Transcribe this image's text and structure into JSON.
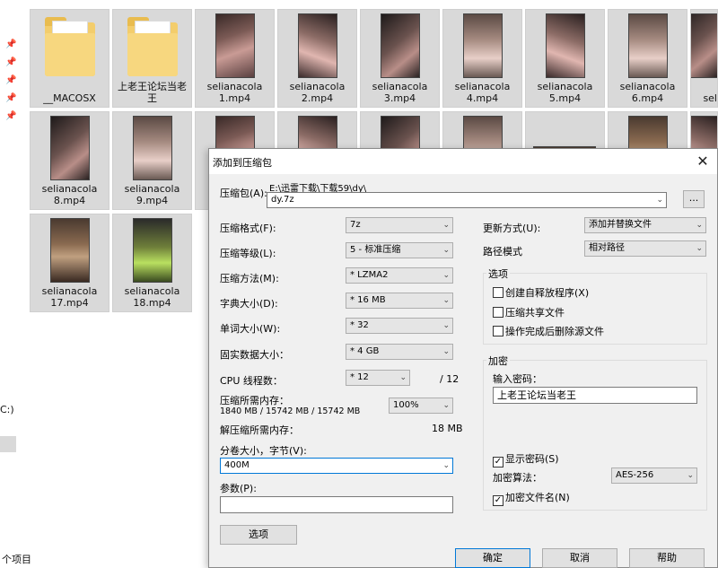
{
  "explorer": {
    "tiles": [
      {
        "label": "__MACOSX",
        "kind": "folder"
      },
      {
        "label": "上老王论坛当老王",
        "kind": "folder"
      },
      {
        "label": "selianacola 1.mp4",
        "kind": "video"
      },
      {
        "label": "selianacola 2.mp4",
        "kind": "video"
      },
      {
        "label": "selianacola 3.mp4",
        "kind": "video"
      },
      {
        "label": "selianacola 4.mp4",
        "kind": "video"
      },
      {
        "label": "selianacola 5.mp4",
        "kind": "video"
      },
      {
        "label": "selianacola 6.mp4",
        "kind": "video"
      },
      {
        "label": "sel",
        "kind": "video"
      },
      {
        "label": "selianacola 8.mp4",
        "kind": "video"
      },
      {
        "label": "selianacola 9.mp4",
        "kind": "video"
      },
      {
        "label": "selianacola 17.mp4",
        "kind": "video"
      },
      {
        "label": "selianacola 18.mp4",
        "kind": "video"
      }
    ],
    "status_drive": "C:)",
    "item_count": "个项目"
  },
  "dialog": {
    "title": "添加到压缩包",
    "archive_label": "压缩包(A):",
    "archive_path": "E:\\迅雷下载\\下载59\\dy\\",
    "archive_name": "dy.7z",
    "browse_label": "...",
    "format_label": "压缩格式(F):",
    "format_value": "7z",
    "level_label": "压缩等级(L):",
    "level_value": "5 - 标准压缩",
    "method_label": "压缩方法(M):",
    "method_value": "* LZMA2",
    "dict_label": "字典大小(D):",
    "dict_value": "* 16 MB",
    "word_label": "单词大小(W):",
    "word_value": "* 32",
    "solid_label": "固实数据大小：",
    "solid_value": "* 4 GB",
    "cpu_label": "CPU 线程数：",
    "cpu_value": "* 12",
    "cpu_total": "/ 12",
    "mem_label": "压缩所需内存：",
    "mem_value": "1840 MB / 15742 MB / 15742 MB",
    "mem_percent": "100%",
    "decomp_label": "解压缩所需内存：",
    "decomp_value": "18 MB",
    "split_label": "分卷大小，字节(V):",
    "split_value": "400M",
    "params_label": "参数(P):",
    "params_value": "",
    "options_button": "选项",
    "update_label": "更新方式(U):",
    "update_value": "添加并替换文件",
    "path_label": "路径模式",
    "path_value": "相对路径",
    "options_group": "选项",
    "cb_sfx": {
      "label": "创建自释放程序(X)",
      "checked": false
    },
    "cb_shared": {
      "label": "压缩共享文件",
      "checked": false
    },
    "cb_delete": {
      "label": "操作完成后删除源文件",
      "checked": false
    },
    "encrypt_group": "加密",
    "password_label": "输入密码：",
    "password_value": "上老王论坛当老王",
    "cb_show_pwd": {
      "label": "显示密码(S)",
      "checked": true
    },
    "enc_method_label": "加密算法：",
    "enc_method_value": "AES-256",
    "cb_enc_names": {
      "label": "加密文件名(N)",
      "checked": true
    },
    "ok_button": "确定",
    "cancel_button": "取消",
    "help_button": "帮助"
  }
}
